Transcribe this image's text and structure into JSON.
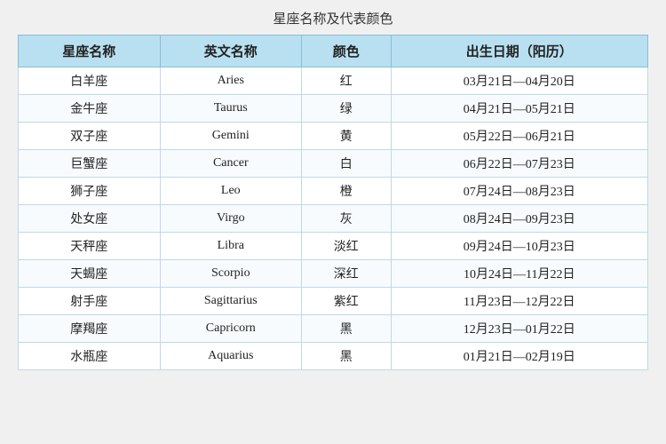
{
  "page": {
    "title": "星座名称及代表颜色",
    "table": {
      "headers": [
        "星座名称",
        "英文名称",
        "颜色",
        "出生日期（阳历）"
      ],
      "rows": [
        [
          "白羊座",
          "Aries",
          "红",
          "03月21日—04月20日"
        ],
        [
          "金牛座",
          "Taurus",
          "绿",
          "04月21日—05月21日"
        ],
        [
          "双子座",
          "Gemini",
          "黄",
          "05月22日—06月21日"
        ],
        [
          "巨蟹座",
          "Cancer",
          "白",
          "06月22日—07月23日"
        ],
        [
          "狮子座",
          "Leo",
          "橙",
          "07月24日—08月23日"
        ],
        [
          "处女座",
          "Virgo",
          "灰",
          "08月24日—09月23日"
        ],
        [
          "天秤座",
          "Libra",
          "淡红",
          "09月24日—10月23日"
        ],
        [
          "天蝎座",
          "Scorpio",
          "深红",
          "10月24日—11月22日"
        ],
        [
          "射手座",
          "Sagittarius",
          "紫红",
          "11月23日—12月22日"
        ],
        [
          "摩羯座",
          "Capricorn",
          "黑",
          "12月23日—01月22日"
        ],
        [
          "水瓶座",
          "Aquarius",
          "黑",
          "01月21日—02月19日"
        ]
      ]
    }
  }
}
